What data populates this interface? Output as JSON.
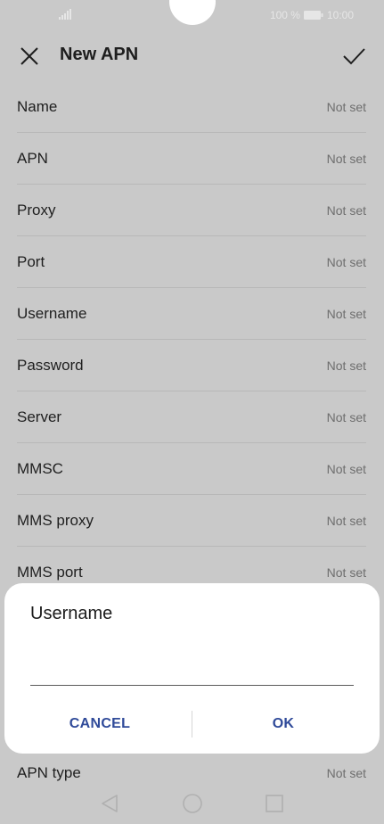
{
  "status_bar": {
    "battery_percent": "100 %",
    "time": "10:00"
  },
  "toolbar": {
    "title": "New APN"
  },
  "settings": [
    {
      "label": "Name",
      "value": "Not set"
    },
    {
      "label": "APN",
      "value": "Not set"
    },
    {
      "label": "Proxy",
      "value": "Not set"
    },
    {
      "label": "Port",
      "value": "Not set"
    },
    {
      "label": "Username",
      "value": "Not set"
    },
    {
      "label": "Password",
      "value": "Not set"
    },
    {
      "label": "Server",
      "value": "Not set"
    },
    {
      "label": "MMSC",
      "value": "Not set"
    },
    {
      "label": "MMS proxy",
      "value": "Not set"
    },
    {
      "label": "MMS port",
      "value": "Not set"
    }
  ],
  "bottom_row": {
    "label": "APN type",
    "value": "Not set"
  },
  "dialog": {
    "title": "Username",
    "input_value": "",
    "cancel_label": "CANCEL",
    "ok_label": "OK"
  }
}
